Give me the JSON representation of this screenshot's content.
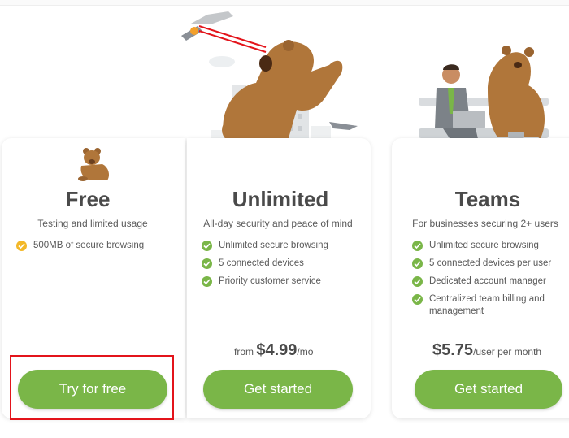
{
  "plans": [
    {
      "title": "Free",
      "subtitle": "Testing and limited usage",
      "features": [
        "500MB of secure browsing"
      ],
      "button": "Try for free"
    },
    {
      "title": "Unlimited",
      "subtitle": "All-day security and peace of mind",
      "features": [
        "Unlimited secure browsing",
        "5 connected devices",
        "Priority customer service"
      ],
      "price_prefix": "from ",
      "price": "$4.99",
      "price_suffix": "/mo",
      "button": "Get started"
    },
    {
      "title": "Teams",
      "subtitle": "For businesses securing 2+ users",
      "features": [
        "Unlimited secure browsing",
        "5 connected devices per user",
        "Dedicated account manager",
        "Centralized team billing and management"
      ],
      "price": "$5.75",
      "price_suffix": "/user per month",
      "button": "Get started"
    }
  ],
  "colors": {
    "accent_green": "#7ab648",
    "check_yellow": "#f3b829",
    "highlight_red": "#e3141b",
    "bear_brown": "#b0763a"
  }
}
